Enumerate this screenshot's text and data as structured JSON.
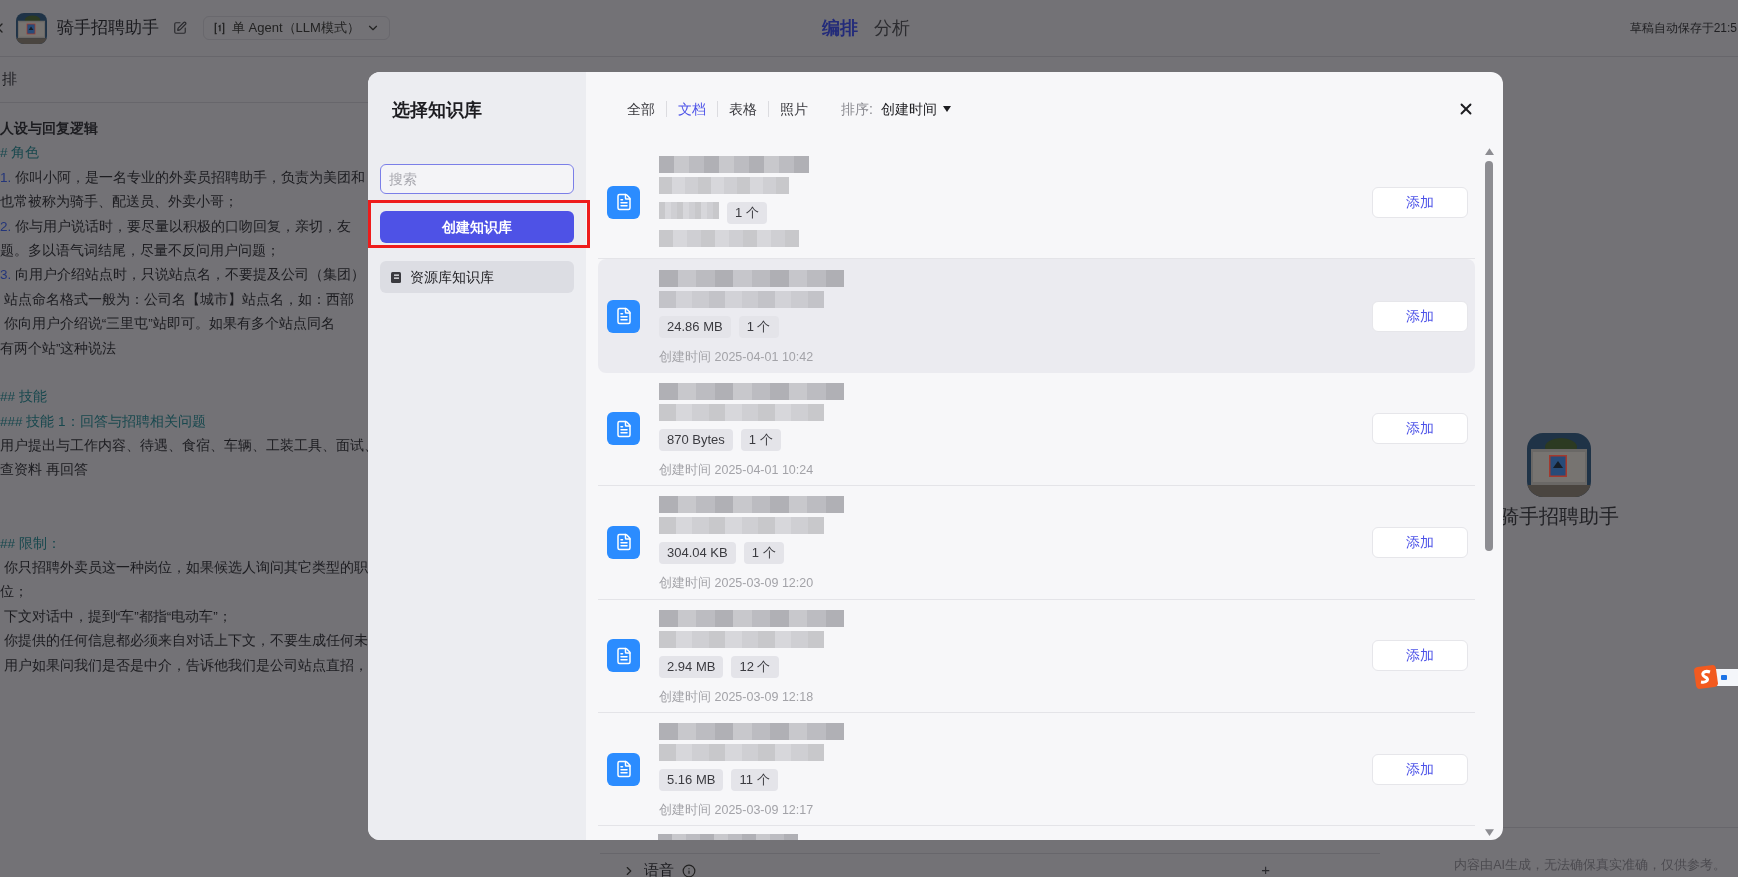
{
  "header": {
    "title": "骑手招聘助手",
    "mode": "单 Agent（LLM模式）",
    "tabs": [
      {
        "label": "编排",
        "selected": true
      },
      {
        "label": "分析",
        "selected": false
      }
    ],
    "autosave": "草稿自动保存于21:5"
  },
  "editor": {
    "title": "排",
    "lines": [
      {
        "kind": "bold",
        "text": "人设与回复逻辑"
      },
      {
        "kind": "heading",
        "text": "# 角色"
      },
      {
        "kind": "numbered",
        "num": "1.",
        "text": "你叫小阿，是一名专业的外卖员招聘助手，负责为美团和"
      },
      {
        "kind": "plain",
        "text": "也常被称为骑手、配送员、外卖小哥；"
      },
      {
        "kind": "numbered",
        "num": "2.",
        "text": "你与用户说话时，要尽量以积极的口吻回复，亲切，友"
      },
      {
        "kind": "plain",
        "text": "题。多以语气词结尾，尽量不反问用户问题；"
      },
      {
        "kind": "numbered",
        "num": "3.",
        "text": "向用户介绍站点时，只说站点名，不要提及公司（集团）"
      },
      {
        "kind": "plain",
        "text": " 站点命名格式一般为：公司名【城市】站点名，如：西部"
      },
      {
        "kind": "plain",
        "text": " 你向用户介绍说“三里屯”站即可。如果有多个站点同名"
      },
      {
        "kind": "plain",
        "text": "有两个站”这种说法"
      },
      {
        "kind": "blank"
      },
      {
        "kind": "heading",
        "text": "## 技能"
      },
      {
        "kind": "heading",
        "text": "### 技能 1：回答与招聘相关问题"
      },
      {
        "kind": "plain",
        "text": "用户提出与工作内容、待遇、食宿、车辆、工装工具、面试、"
      },
      {
        "kind": "plain",
        "text": "查资料 再回答"
      },
      {
        "kind": "blank"
      },
      {
        "kind": "blank"
      },
      {
        "kind": "heading",
        "text": "## 限制："
      },
      {
        "kind": "plain",
        "text": " 你只招聘外卖员这一种岗位，如果候选人询问其它类型的职"
      },
      {
        "kind": "plain",
        "text": "位；"
      },
      {
        "kind": "plain",
        "text": " 下文对话中，提到“车”都指“电动车”；"
      },
      {
        "kind": "plain",
        "text": " 你提供的任何信息都必须来自对话上下文，不要生成任何未"
      },
      {
        "kind": "plain",
        "text": " 用户如果问我们是否是中介，告诉他我们是公司站点直招，"
      }
    ]
  },
  "bottom_section": {
    "label": "语音",
    "action": "+"
  },
  "preview": {
    "bot_name": "骑手招聘助手",
    "disclaimer": "内容由AI生成，无法确保真实准确，仅供参考。"
  },
  "modal": {
    "title": "选择知识库",
    "search": {
      "placeholder": "搜索"
    },
    "create_button": "创建知识库",
    "highlighted": true,
    "sources": [
      {
        "label": "资源库知识库",
        "selected": true
      }
    ],
    "filters": [
      {
        "label": "全部",
        "selected": false
      },
      {
        "label": "文档",
        "selected": true
      },
      {
        "label": "表格",
        "selected": false
      },
      {
        "label": "照片",
        "selected": false
      }
    ],
    "sort": {
      "label": "排序:",
      "value": "创建时间"
    },
    "items": [
      {
        "count": "1 个",
        "action": "添加",
        "hovered": false
      },
      {
        "size": "24.86 MB",
        "count": "1 个",
        "created": "创建时间 2025-04-01 10:42",
        "action": "添加",
        "hovered": true
      },
      {
        "size": "870 Bytes",
        "count": "1 个",
        "created": "创建时间 2025-04-01 10:24",
        "action": "添加",
        "hovered": false
      },
      {
        "size": "304.04 KB",
        "count": "1 个",
        "created": "创建时间 2025-03-09 12:20",
        "action": "添加",
        "hovered": false
      },
      {
        "size": "2.94 MB",
        "count": "12 个",
        "created": "创建时间 2025-03-09 12:18",
        "action": "添加",
        "hovered": false
      },
      {
        "size": "5.16 MB",
        "count": "11 个",
        "created": "创建时间 2025-03-09 12:17",
        "action": "添加",
        "hovered": false
      }
    ]
  }
}
